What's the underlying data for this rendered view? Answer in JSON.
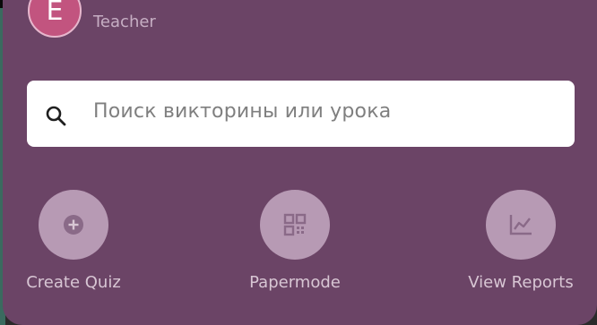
{
  "profile": {
    "avatar_letter": "E",
    "role": "Teacher"
  },
  "search": {
    "placeholder": "Поиск викторины или урока"
  },
  "actions": [
    {
      "label": "Create Quiz",
      "icon": "plus-circle-icon"
    },
    {
      "label": "Papermode",
      "icon": "qr-code-icon"
    },
    {
      "label": "View Reports",
      "icon": "line-chart-icon"
    }
  ],
  "colors": {
    "panel": "#6b4466",
    "avatar": "#c2547f",
    "action_circle": "#b79ab4",
    "label_text": "#d8c6d4"
  }
}
